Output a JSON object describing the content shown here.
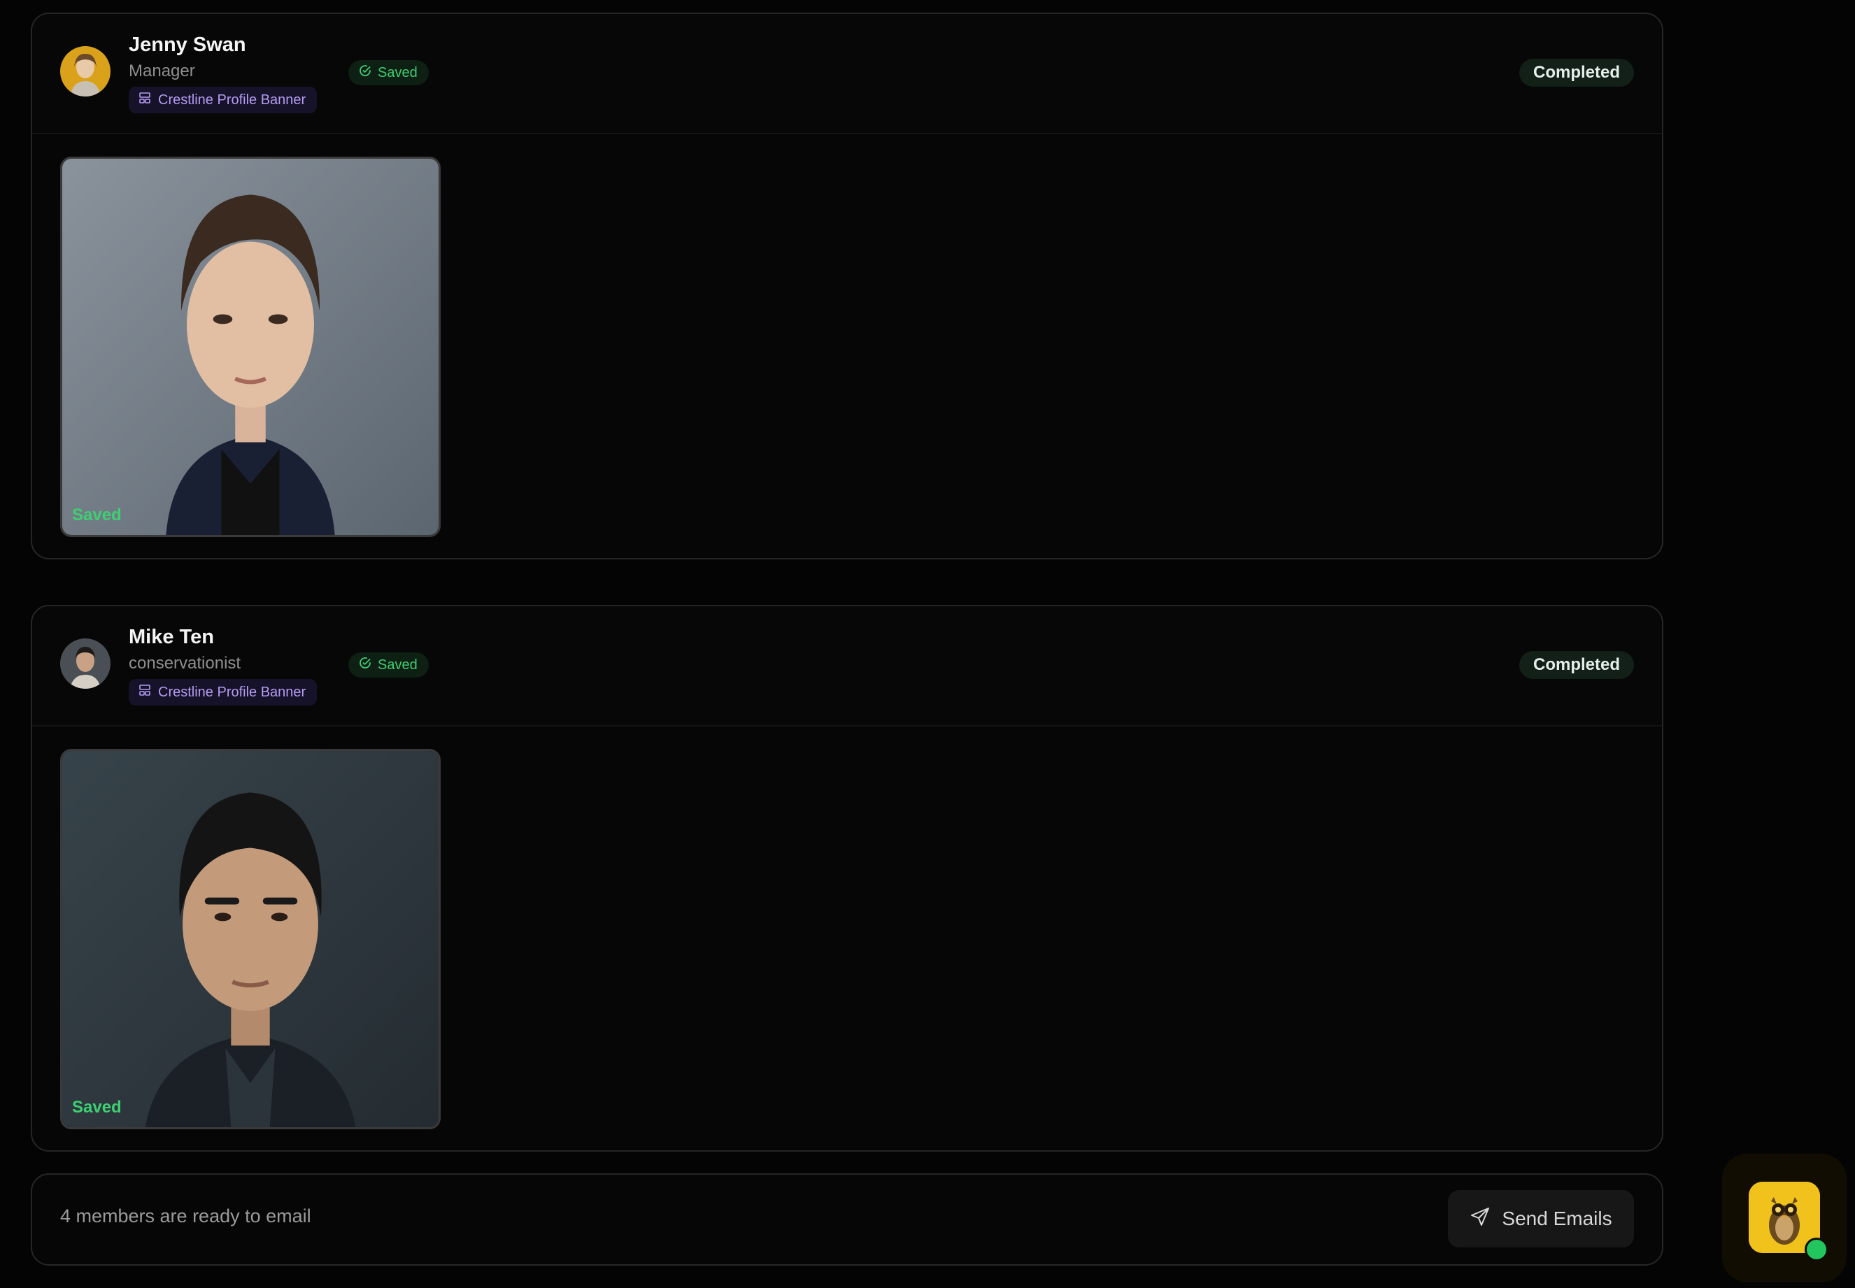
{
  "members": [
    {
      "name": "Jenny Swan",
      "role": "Manager",
      "template": "Crestline Profile Banner",
      "saved_label": "Saved",
      "status": "Completed",
      "photo_label": "Saved"
    },
    {
      "name": "Mike Ten",
      "role": "conservationist",
      "template": "Crestline Profile Banner",
      "saved_label": "Saved",
      "status": "Completed",
      "photo_label": "Saved"
    }
  ],
  "footer": {
    "ready_text": "4 members are ready to email",
    "send_label": "Send Emails"
  },
  "icons": {
    "saved": "check-circle-icon",
    "template": "layout-icon",
    "send": "send-icon",
    "assistant": "owl-mascot-icon"
  },
  "colors": {
    "accent_green": "#3ecf73",
    "template_purple": "#b49cf0",
    "assistant_yellow": "#f1c21b"
  }
}
